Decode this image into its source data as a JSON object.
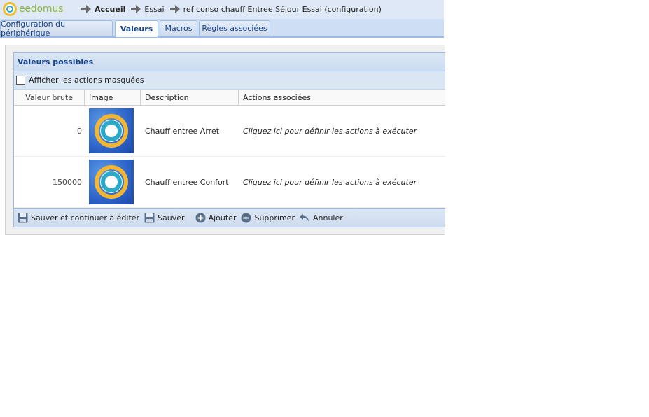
{
  "app": {
    "logo_text": "eedomus"
  },
  "breadcrumb": [
    "Accueil",
    "Essai",
    "ref conso chauff Entree Séjour Essai (configuration)"
  ],
  "tabs": [
    {
      "label": "Configuration du périphérique",
      "active": false
    },
    {
      "label": "Valeurs",
      "active": true
    },
    {
      "label": "Macros",
      "active": false
    },
    {
      "label": "Règles associées",
      "active": false
    }
  ],
  "panel": {
    "title": "Valeurs possibles",
    "show_hidden_label": "Afficher les actions masquées",
    "show_hidden_checked": false
  },
  "grid": {
    "columns": [
      "Valeur brute",
      "Image",
      "Description",
      "Actions associées"
    ],
    "rows": [
      {
        "raw": "0",
        "image": "thermostat-ring-icon",
        "description": "Chauff entree Arret",
        "actions": "Cliquez ici pour définir les actions à exécuter"
      },
      {
        "raw": "150000",
        "image": "thermostat-ring-icon",
        "description": "Chauff entree Confort",
        "actions": "Cliquez ici pour définir les actions à exécuter"
      }
    ]
  },
  "toolbar": {
    "save_continue": "Sauver et continuer à éditer",
    "save": "Sauver",
    "add": "Ajouter",
    "delete": "Supprimer",
    "cancel": "Annuler"
  },
  "colors": {
    "accent": "#15428b",
    "panel_border": "#99bbe8",
    "logo_green": "#8bb83a",
    "logo_ring": "#f0c030"
  }
}
